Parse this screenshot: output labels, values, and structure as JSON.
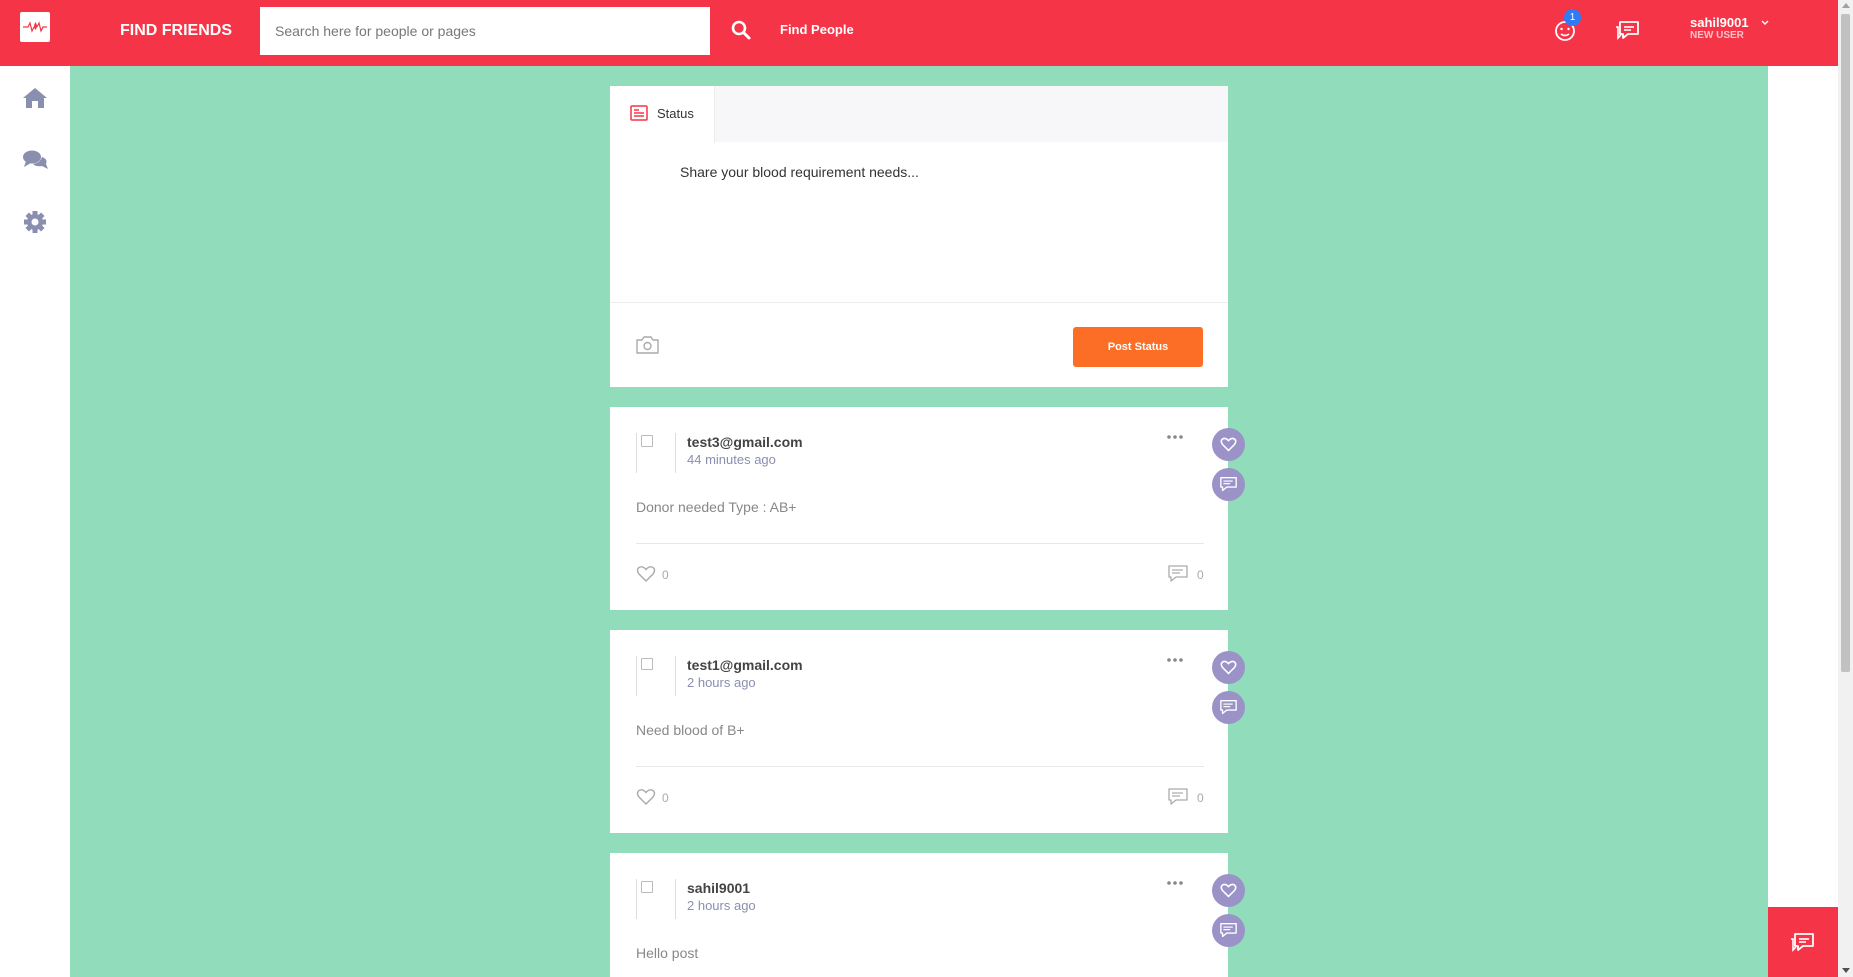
{
  "header": {
    "logo": "blood-drop-pulse-logo",
    "title": "FIND FRIENDS",
    "search_placeholder": "Search here for people or pages",
    "find_people": "Find People",
    "notification_count": "1",
    "user": {
      "name": "sahil9001",
      "role": "NEW USER"
    }
  },
  "sidebar": {
    "items": [
      {
        "icon": "home-icon"
      },
      {
        "icon": "chat-bubbles-icon"
      },
      {
        "icon": "gear-icon"
      }
    ]
  },
  "composer": {
    "tab_label": "Status",
    "placeholder": "Share your blood requirement needs...",
    "post_button": "Post Status"
  },
  "posts": [
    {
      "author": "test3@gmail.com",
      "time": "44 minutes ago",
      "text": "Donor needed Type : AB+",
      "likes": "0",
      "comments": "0"
    },
    {
      "author": "test1@gmail.com",
      "time": "2 hours ago",
      "text": "Need blood of B+",
      "likes": "0",
      "comments": "0"
    },
    {
      "author": "sahil9001",
      "time": "2 hours ago",
      "text": "Hello post"
    }
  ],
  "colors": {
    "header": "#f53447",
    "background": "#91dcba",
    "post_button": "#fc6d25",
    "float_buttons": "#9b92c8",
    "badge": "#2f7bf5"
  }
}
